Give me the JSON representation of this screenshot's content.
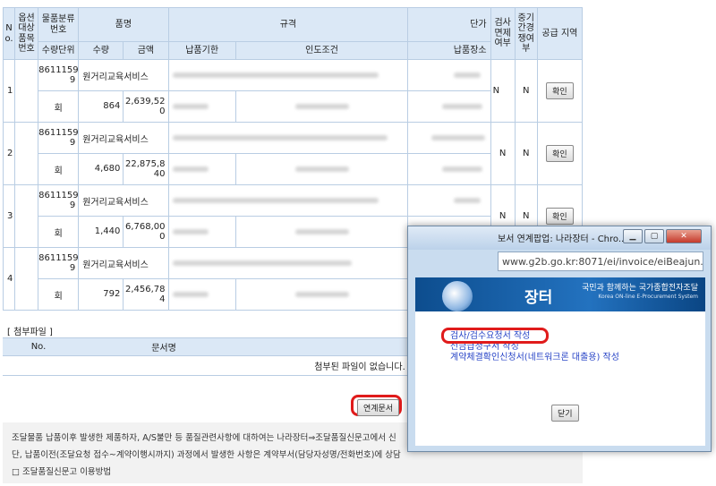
{
  "headers": {
    "no": "N o.",
    "option_item_no": "옵션 대상 품목 번호",
    "class_no": "물품분류 번호",
    "item_name": "품명",
    "spec": "규격",
    "unit_price": "단가",
    "inspect_exempt": "검사 면제 여부",
    "mid_ins": "중기 간경 쟁여 부",
    "supply_region": "공급 지역",
    "qty_unit": "수량단위",
    "qty": "수량",
    "amount": "금액",
    "deadline": "납품기한",
    "delivery_terms": "인도조건",
    "delivery_place": "납품장소"
  },
  "rows": [
    {
      "no": "1",
      "class_no": "8611159 9",
      "name": "원거리교육서비스",
      "unit": "회",
      "qty": "864",
      "amount": "2,639,52 0",
      "inspect": "N",
      "mid": "N",
      "action": "확인"
    },
    {
      "no": "2",
      "class_no": "8611159 9",
      "name": "원거리교육서비스",
      "unit": "회",
      "qty": "4,680",
      "amount": "22,875,8 40",
      "inspect": "N",
      "mid": "N",
      "action": "확인"
    },
    {
      "no": "3",
      "class_no": "8611159 9",
      "name": "원거리교육서비스",
      "unit": "회",
      "qty": "1,440",
      "amount": "6,768,00 0",
      "inspect": "N",
      "mid": "N",
      "action": "확인"
    },
    {
      "no": "4",
      "class_no": "8611159 9",
      "name": "원거리교육서비스",
      "unit": "회",
      "qty": "792",
      "amount": "2,456,78 4",
      "inspect": "",
      "mid": "",
      "action": ""
    }
  ],
  "attach": {
    "title": "[ 첨부파일 ]",
    "col_no": "No.",
    "col_doc": "문서명",
    "empty": "첨부된 파일이 없습니다."
  },
  "link_button": "연계문서",
  "notice": {
    "line1": "조달물품 납품이후 발생한 제품하자, A/S불만 등 품질관련사항에 대하여는 나라장터⇒조달품질신문고에서 신",
    "line2": "단, 납품이전(조달요청 접수~계약이행시까지) 과정에서 발생한 사항은 계약부서(담당자성명/전화번호)에 상담",
    "line3": "□ 조달품질신문고 이용방법"
  },
  "popup": {
    "title": "보서 연계팝업: 나라장터 - Chro...",
    "url": "www.g2b.go.kr:8071/ei/invoice/eiBeajun...",
    "brand": "장터",
    "slogan": "국민과 함께하는 국가종합전자조달",
    "slogan_en": "Korea ON-line E-Procurement System",
    "menu": [
      "검사/검수요청서 작성",
      "선금급청구서 작성",
      "계약체결확인신청서(네트워크론 대출용) 작성"
    ],
    "close": "닫기"
  }
}
